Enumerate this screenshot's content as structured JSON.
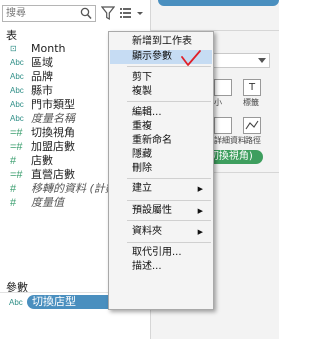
{
  "search": {
    "placeholder": "搜尋"
  },
  "toolbar": {
    "filter_icon": "filter-icon",
    "view_icon": "list-view-icon",
    "dropdown_icon": "chevron-down-icon"
  },
  "tables_header": "表",
  "fields": [
    {
      "type_icon": "date-icon",
      "glyph": "⊡",
      "label": "Month",
      "italic": false
    },
    {
      "type_icon": "abc",
      "glyph": "Abc",
      "label": "區域",
      "italic": false
    },
    {
      "type_icon": "abc",
      "glyph": "Abc",
      "label": "品牌",
      "italic": false
    },
    {
      "type_icon": "abc",
      "glyph": "Abc",
      "label": "縣市",
      "italic": false
    },
    {
      "type_icon": "abc",
      "glyph": "Abc",
      "label": "門市類型",
      "italic": false
    },
    {
      "type_icon": "abc",
      "glyph": "Abc",
      "label": "度量名稱",
      "italic": true
    },
    {
      "type_icon": "calc-number",
      "glyph": "=#",
      "label": "切換視角",
      "italic": false
    },
    {
      "type_icon": "calc-number",
      "glyph": "=#",
      "label": "加盟店數",
      "italic": false
    },
    {
      "type_icon": "number",
      "glyph": "#",
      "label": "店數",
      "italic": false
    },
    {
      "type_icon": "calc-number",
      "glyph": "=#",
      "label": "直營店數",
      "italic": false
    },
    {
      "type_icon": "number",
      "glyph": "#",
      "label": "移轉的資料 (計數)",
      "italic": true
    },
    {
      "type_icon": "number",
      "glyph": "#",
      "label": "度量值",
      "italic": true
    }
  ],
  "params_header": "參數",
  "parameter": {
    "glyph": "Abc",
    "label": "切換店型"
  },
  "right_pane": {
    "card1_label": "小",
    "card2_label": "標籤",
    "card2_glyph": "T",
    "card3_label": "詳細資料",
    "card4_label": "路徑",
    "pill_label": "(切換視角)"
  },
  "context_menu": {
    "items": [
      {
        "label": "新增到工作表",
        "highlight": false,
        "submenu": false
      },
      {
        "label": "顯示參數",
        "highlight": true,
        "submenu": false
      },
      {
        "separator": true
      },
      {
        "label": "剪下",
        "highlight": false,
        "submenu": false
      },
      {
        "label": "複製",
        "highlight": false,
        "submenu": false
      },
      {
        "separator": true
      },
      {
        "label": "編輯...",
        "highlight": false,
        "submenu": false
      },
      {
        "label": "重複",
        "highlight": false,
        "submenu": false
      },
      {
        "label": "重新命名",
        "highlight": false,
        "submenu": false
      },
      {
        "label": "隱藏",
        "highlight": false,
        "submenu": false
      },
      {
        "label": "刪除",
        "highlight": false,
        "submenu": false
      },
      {
        "separator": true
      },
      {
        "label": "建立",
        "highlight": false,
        "submenu": true
      },
      {
        "separator": true
      },
      {
        "label": "預設屬性",
        "highlight": false,
        "submenu": true
      },
      {
        "separator": true
      },
      {
        "label": "資料夾",
        "highlight": false,
        "submenu": true
      },
      {
        "separator": true
      },
      {
        "label": "取代引用...",
        "highlight": false,
        "submenu": false
      },
      {
        "label": "描述...",
        "highlight": false,
        "submenu": false
      }
    ]
  },
  "colors": {
    "accent": "#4a8fbf",
    "highlight": "#c6dcf3",
    "field_icon": "#2f8f87",
    "annotation": "#e0202a"
  }
}
